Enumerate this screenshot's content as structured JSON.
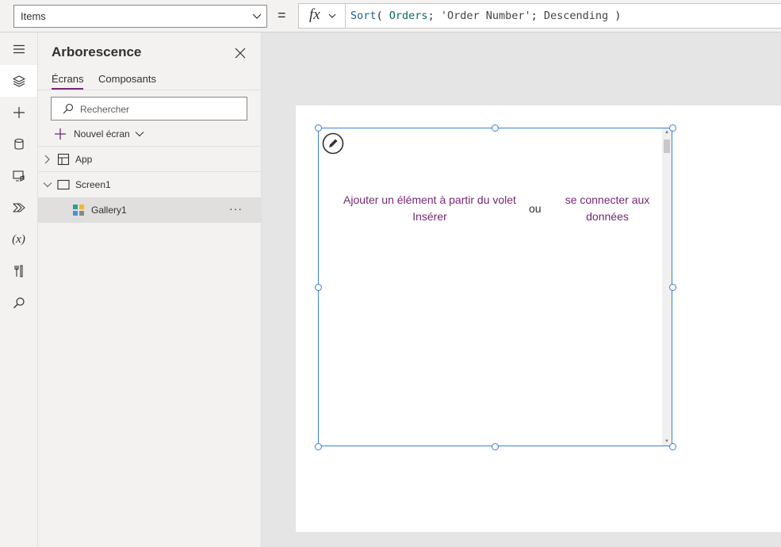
{
  "formula_bar": {
    "property": "Items",
    "equals": "=",
    "fx_label": "fx",
    "formula": {
      "fn": "Sort",
      "open": "( ",
      "datasource": "Orders",
      "sep1": "; ",
      "column": "'Order Number'",
      "sep2": "; ",
      "order": "Descending",
      "close": " )"
    }
  },
  "left_rail": {
    "items": [
      {
        "icon": "hamburger-menu-icon"
      },
      {
        "icon": "layers-icon",
        "active": true
      },
      {
        "icon": "plus-icon"
      },
      {
        "icon": "database-icon"
      },
      {
        "icon": "media-icon"
      },
      {
        "icon": "power-automate-icon"
      },
      {
        "icon": "variables-icon",
        "text": "(x)"
      },
      {
        "icon": "tools-icon"
      },
      {
        "icon": "search-icon"
      }
    ]
  },
  "tree_panel": {
    "title": "Arborescence",
    "tabs": [
      "Écrans",
      "Composants"
    ],
    "search_placeholder": "Rechercher",
    "new_screen_label": "Nouvel écran",
    "items": [
      {
        "label": "App"
      },
      {
        "label": "Screen1"
      },
      {
        "label": "Gallery1",
        "more": "···"
      }
    ]
  },
  "gallery": {
    "insert_text": "Ajouter un élément à partir du volet Insérer",
    "or_text": "ou",
    "connect_text": "se connecter aux données"
  },
  "colors": {
    "accent": "#742774",
    "selection": "#3b7fd4"
  }
}
